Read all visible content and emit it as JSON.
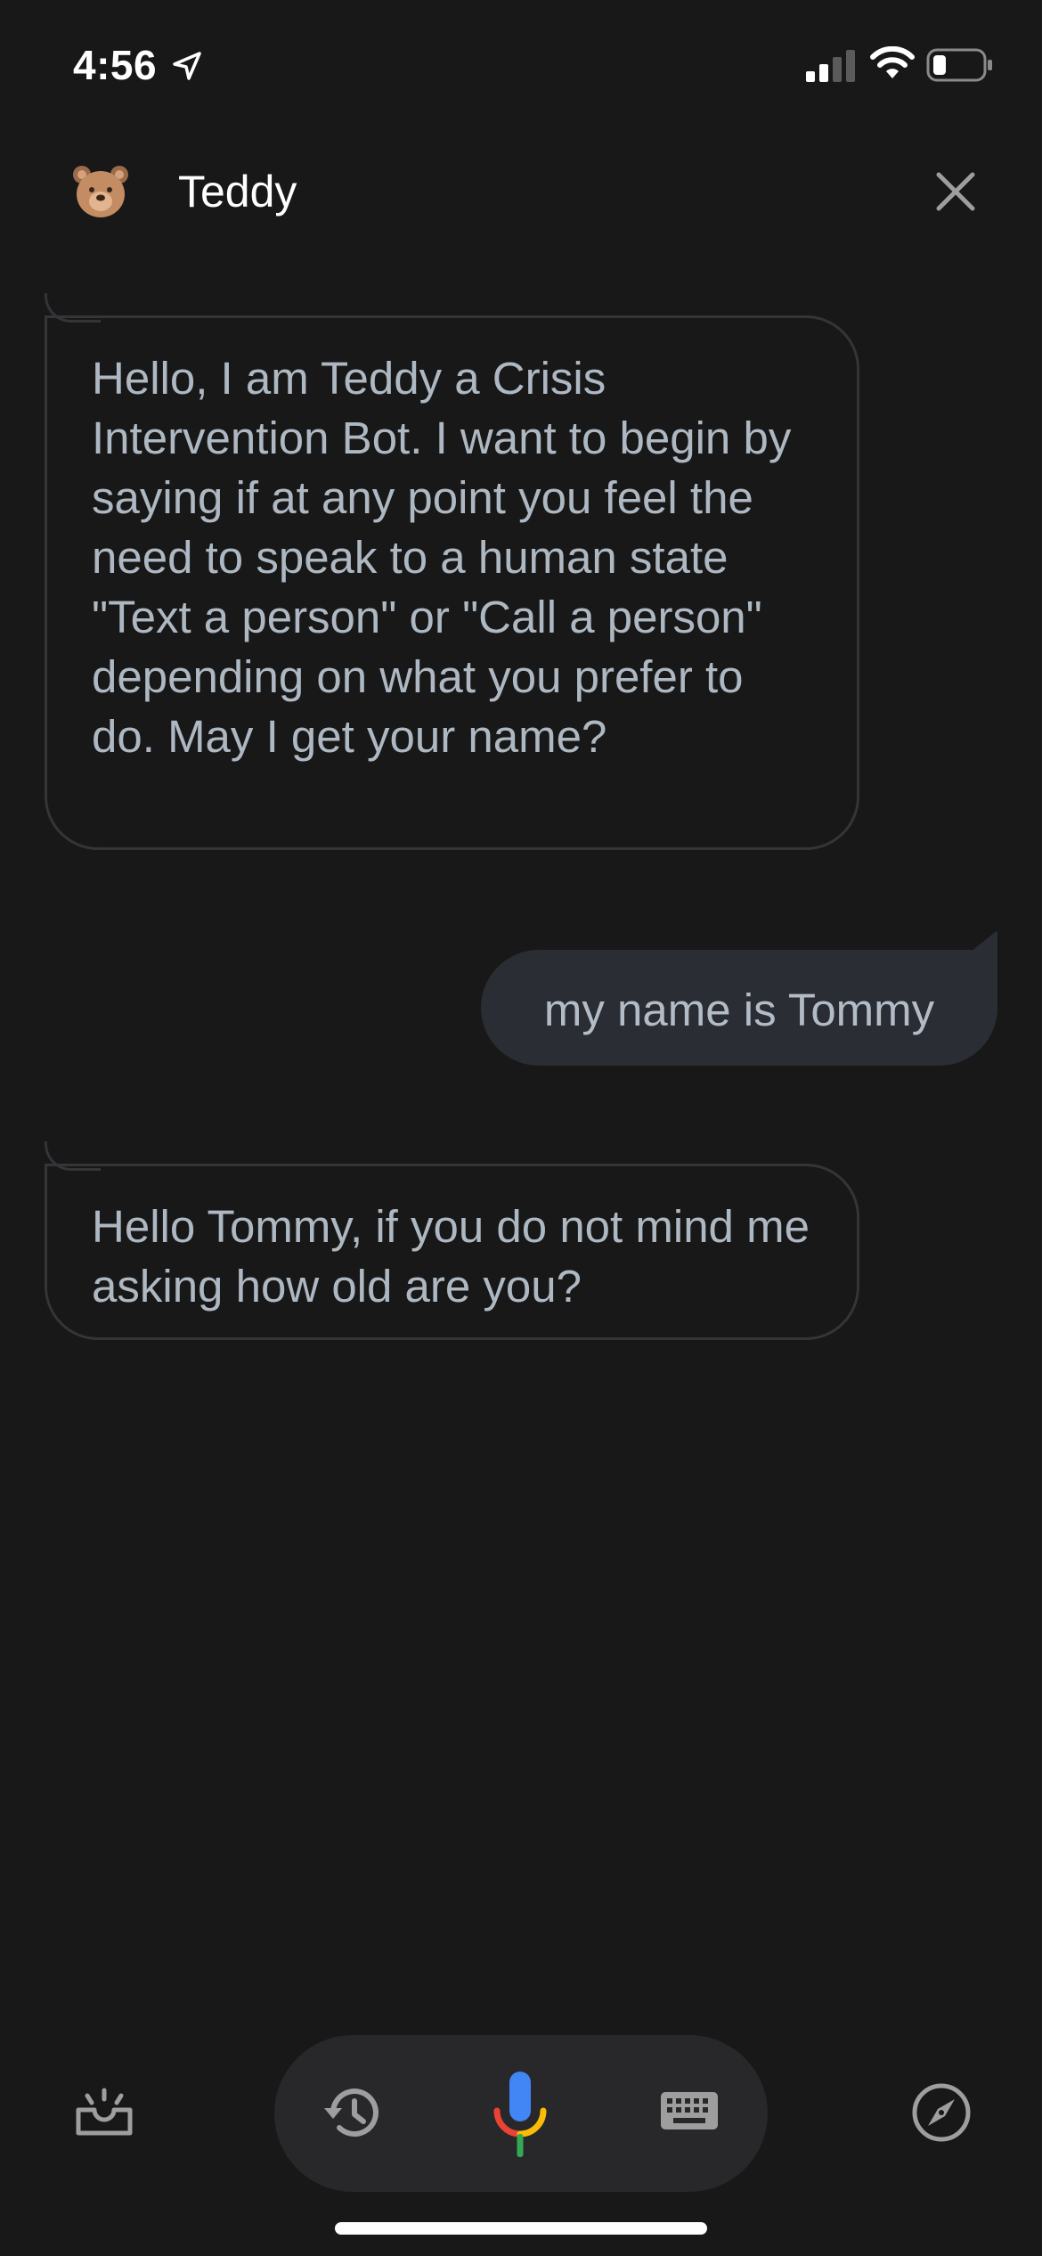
{
  "status_bar": {
    "time": "4:56",
    "icons": [
      "location-arrow-icon",
      "cellular-signal-icon",
      "wifi-icon",
      "battery-icon"
    ]
  },
  "header": {
    "bot_name": "Teddy",
    "avatar_icon": "teddy-bear-icon",
    "close_icon": "close-icon"
  },
  "messages": [
    {
      "sender": "bot",
      "text": "Hello, I am Teddy a Crisis Intervention Bot. I want to begin by saying if at any point you feel the need to speak to a human state \"Text a person\" or \"Call a person\" depending on what you prefer to do. May I get your name?"
    },
    {
      "sender": "user",
      "text": "my name is Tommy"
    },
    {
      "sender": "bot",
      "text": "Hello Tommy, if you do not mind me asking how old are you?"
    }
  ],
  "bottom_bar": {
    "icons": [
      "inbox-updates-icon",
      "history-icon",
      "microphone-icon",
      "keyboard-icon",
      "compass-icon"
    ]
  },
  "colors": {
    "background": "#181818",
    "bot_text": "#aeb8c2",
    "user_bubble": "#2a2d33",
    "mic_blue": "#4285f4",
    "mic_red": "#ea4335",
    "mic_yellow": "#fbbc05",
    "mic_green": "#34a853"
  }
}
